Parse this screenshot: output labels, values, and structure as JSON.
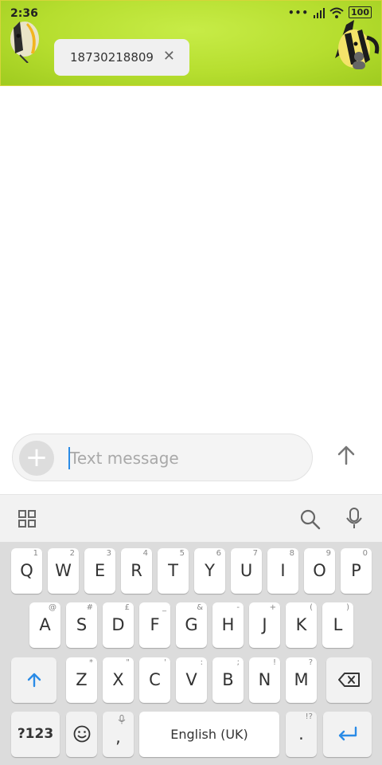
{
  "status": {
    "time": "2:36",
    "battery": "100"
  },
  "recipient": {
    "number": "18730218809",
    "remove_icon": "close-icon"
  },
  "compose": {
    "placeholder": "Text message",
    "attach_icon": "plus-icon",
    "send_icon": "send-arrow-icon"
  },
  "toolbar": {
    "icons": [
      "apps-grid-icon",
      "search-icon",
      "microphone-icon"
    ]
  },
  "keyboard": {
    "row1": [
      {
        "label": "Q",
        "hint": "1"
      },
      {
        "label": "W",
        "hint": "2"
      },
      {
        "label": "E",
        "hint": "3"
      },
      {
        "label": "R",
        "hint": "4"
      },
      {
        "label": "T",
        "hint": "5"
      },
      {
        "label": "Y",
        "hint": "6"
      },
      {
        "label": "U",
        "hint": "7"
      },
      {
        "label": "I",
        "hint": "8"
      },
      {
        "label": "O",
        "hint": "9"
      },
      {
        "label": "P",
        "hint": "0"
      }
    ],
    "row2": [
      {
        "label": "A",
        "hint": "@"
      },
      {
        "label": "S",
        "hint": "#"
      },
      {
        "label": "D",
        "hint": "£"
      },
      {
        "label": "F",
        "hint": "_"
      },
      {
        "label": "G",
        "hint": "&"
      },
      {
        "label": "H",
        "hint": "-"
      },
      {
        "label": "J",
        "hint": "+"
      },
      {
        "label": "K",
        "hint": "("
      },
      {
        "label": "L",
        "hint": ")"
      }
    ],
    "row3": [
      {
        "label": "Z",
        "hint": "*"
      },
      {
        "label": "X",
        "hint": "\""
      },
      {
        "label": "C",
        "hint": "'"
      },
      {
        "label": "V",
        "hint": ":"
      },
      {
        "label": "B",
        "hint": ";"
      },
      {
        "label": "N",
        "hint": "!"
      },
      {
        "label": "M",
        "hint": "?"
      }
    ],
    "symbols_label": "?123",
    "comma": ",",
    "period": ".",
    "period_hint": "!?",
    "space_label": "English (UK)"
  },
  "colors": {
    "header_green": "#b6de2f",
    "accent_blue": "#2a8be6"
  }
}
